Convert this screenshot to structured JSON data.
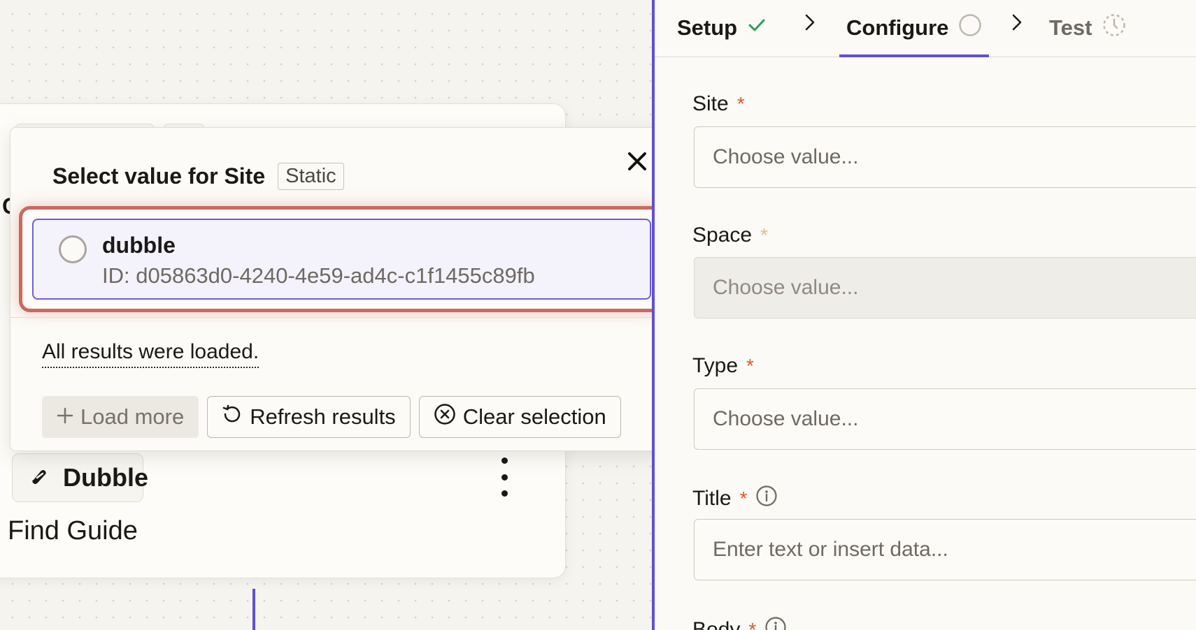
{
  "canvas": {
    "card": {
      "partial_heading_letter": "C",
      "app_name": "Dubble",
      "step_title": "Find Guide"
    }
  },
  "popover": {
    "title": "Select value for Site",
    "badge": "Static",
    "options": [
      {
        "name": "dubble",
        "id_text": "ID: d05863d0-4240-4e59-ad4c-c1f1455c89fb"
      }
    ],
    "results_note": "All results were loaded.",
    "buttons": {
      "load_more": "Load more",
      "refresh": "Refresh results",
      "clear": "Clear selection"
    }
  },
  "panel": {
    "tabs": [
      {
        "label": "Setup"
      },
      {
        "label": "Configure"
      },
      {
        "label": "Test"
      }
    ],
    "required_mark": "*",
    "fields": [
      {
        "label": "Site",
        "placeholder": "Choose value..."
      },
      {
        "label": "Space",
        "placeholder": "Choose value..."
      },
      {
        "label": "Type",
        "placeholder": "Choose value..."
      },
      {
        "label": "Title",
        "placeholder": "Enter text or insert data..."
      },
      {
        "label": "Body"
      }
    ]
  },
  "colors": {
    "accent": "#5f4fd6",
    "required": "#e2572b",
    "success": "#2e9e5b",
    "highlight": "#c96a5f"
  },
  "icons": [
    "check-icon",
    "circle-icon",
    "timer-icon",
    "chevron-right-icon",
    "close-icon",
    "plus-icon",
    "refresh-icon",
    "clear-circle-icon",
    "info-icon",
    "dubble-logo-icon",
    "more-vertical-icon"
  ]
}
